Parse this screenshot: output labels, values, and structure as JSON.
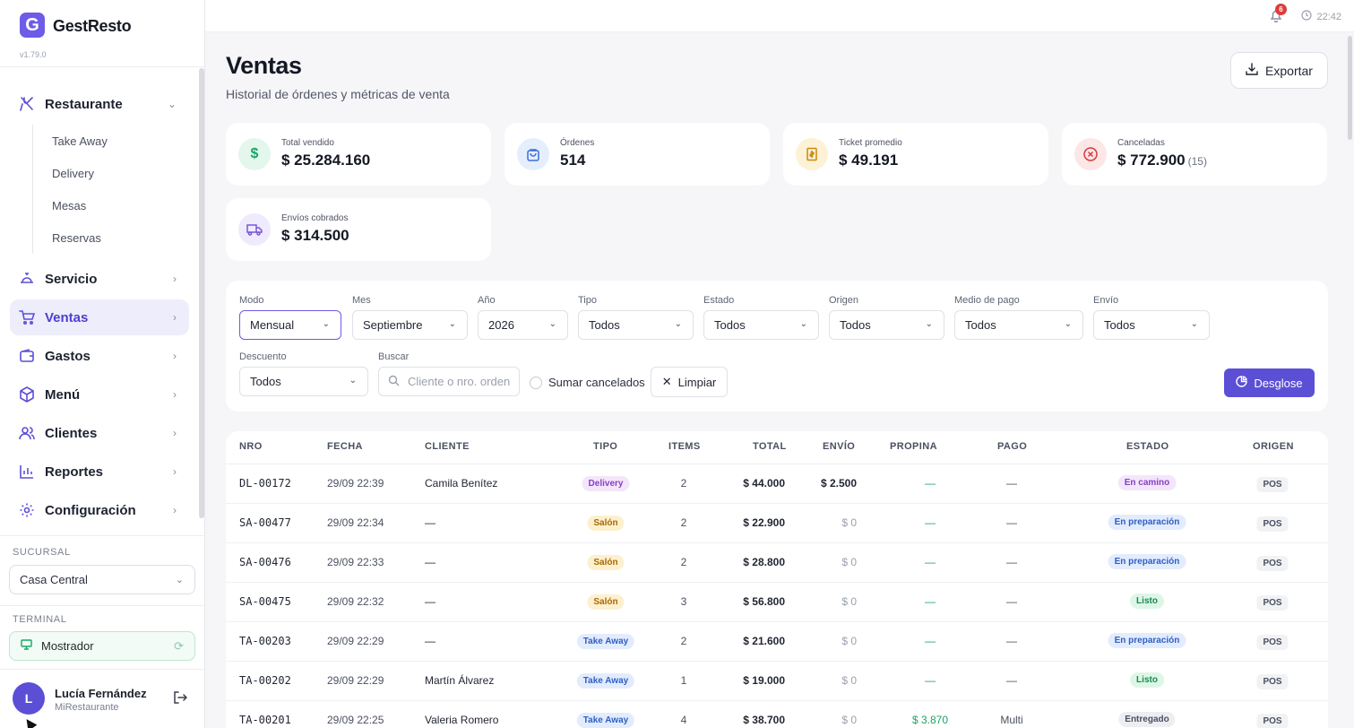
{
  "app": {
    "name": "GestResto",
    "logo_letter": "G",
    "version": "v1.79.0",
    "accent_color": "#5b4fd6"
  },
  "sidebar": {
    "restaurant": {
      "label": "Restaurante",
      "icon": "utensils-icon",
      "subitems": [
        "Take Away",
        "Delivery",
        "Mesas",
        "Reservas"
      ]
    },
    "items": [
      {
        "label": "Servicio",
        "icon": "service-bell-icon"
      },
      {
        "label": "Ventas",
        "icon": "cart-icon",
        "active": true
      },
      {
        "label": "Gastos",
        "icon": "wallet-icon"
      },
      {
        "label": "Menú",
        "icon": "box-icon"
      },
      {
        "label": "Clientes",
        "icon": "users-icon"
      },
      {
        "label": "Reportes",
        "icon": "bar-chart-icon"
      },
      {
        "label": "Configuración",
        "icon": "gear-icon"
      }
    ],
    "branch_label": "SUCURSAL",
    "branch_value": "Casa Central",
    "terminal_label": "TERMINAL",
    "terminal_value": "Mostrador",
    "user": {
      "initial": "L",
      "name": "Lucía Fernández",
      "restaurant": "MiRestaurante"
    }
  },
  "topbar": {
    "notifications": "6",
    "time": "22:42"
  },
  "header": {
    "title": "Ventas",
    "subtitle": "Historial de órdenes y métricas de venta",
    "export_label": "Exportar"
  },
  "stats": [
    {
      "label": "Total vendido",
      "value": "$ 25.284.160",
      "icon": "dollar-icon",
      "bg": "#e3f7ec",
      "fg": "#1aa366"
    },
    {
      "label": "Órdenes",
      "value": "514",
      "icon": "bag-icon",
      "bg": "#e5eefc",
      "fg": "#3b6fd8"
    },
    {
      "label": "Ticket promedio",
      "value": "$ 49.191",
      "icon": "receipt-icon",
      "bg": "#fdf1d6",
      "fg": "#c98a0a"
    },
    {
      "label": "Canceladas",
      "value": "$ 772.900",
      "extra": "(15)",
      "icon": "cancel-circle-icon",
      "bg": "#fde6e6",
      "fg": "#d63a3a"
    },
    {
      "label": "Envíos cobrados",
      "value": "$ 314.500",
      "icon": "truck-icon",
      "bg": "#efeafc",
      "fg": "#7a56d8"
    }
  ],
  "filters": {
    "modo": {
      "label": "Modo",
      "value": "Mensual"
    },
    "mes": {
      "label": "Mes",
      "value": "Septiembre"
    },
    "anio": {
      "label": "Año",
      "value": "2026"
    },
    "tipo": {
      "label": "Tipo",
      "value": "Todos"
    },
    "estado": {
      "label": "Estado",
      "value": "Todos"
    },
    "origen": {
      "label": "Origen",
      "value": "Todos"
    },
    "medio_pago": {
      "label": "Medio de pago",
      "value": "Todos"
    },
    "envio": {
      "label": "Envío",
      "value": "Todos"
    },
    "descuento": {
      "label": "Descuento",
      "value": "Todos"
    },
    "buscar": {
      "label": "Buscar",
      "placeholder": "Cliente o nro. orden"
    },
    "sumar_cancelados": "Sumar cancelados",
    "limpiar": "Limpiar",
    "desglose": "Desglose"
  },
  "table": {
    "headers": {
      "nro": "NRO",
      "fecha": "FECHA",
      "cliente": "CLIENTE",
      "tipo": "TIPO",
      "items": "ITEMS",
      "total": "TOTAL",
      "envio": "ENVÍO",
      "propina": "PROPINA",
      "pago": "PAGO",
      "estado": "ESTADO",
      "origen": "ORIGEN"
    },
    "rows": [
      {
        "nro": "DL-00172",
        "fecha": "29/09 22:39",
        "cliente": "Camila Benítez",
        "tipo": "Delivery",
        "items": "2",
        "total": "$ 44.000",
        "envio": "$ 2.500",
        "propina": "—",
        "pago": "—",
        "estado": "En camino",
        "origen": "POS"
      },
      {
        "nro": "SA-00477",
        "fecha": "29/09 22:34",
        "cliente": "—",
        "tipo": "Salón",
        "items": "2",
        "total": "$ 22.900",
        "envio": "$ 0",
        "propina": "—",
        "pago": "—",
        "estado": "En preparación",
        "origen": "POS"
      },
      {
        "nro": "SA-00476",
        "fecha": "29/09 22:33",
        "cliente": "—",
        "tipo": "Salón",
        "items": "2",
        "total": "$ 28.800",
        "envio": "$ 0",
        "propina": "—",
        "pago": "—",
        "estado": "En preparación",
        "origen": "POS"
      },
      {
        "nro": "SA-00475",
        "fecha": "29/09 22:32",
        "cliente": "—",
        "tipo": "Salón",
        "items": "3",
        "total": "$ 56.800",
        "envio": "$ 0",
        "propina": "—",
        "pago": "—",
        "estado": "Listo",
        "origen": "POS"
      },
      {
        "nro": "TA-00203",
        "fecha": "29/09 22:29",
        "cliente": "—",
        "tipo": "Take Away",
        "items": "2",
        "total": "$ 21.600",
        "envio": "$ 0",
        "propina": "—",
        "pago": "—",
        "estado": "En preparación",
        "origen": "POS"
      },
      {
        "nro": "TA-00202",
        "fecha": "29/09 22:29",
        "cliente": "Martín Álvarez",
        "tipo": "Take Away",
        "items": "1",
        "total": "$ 19.000",
        "envio": "$ 0",
        "propina": "—",
        "pago": "—",
        "estado": "Listo",
        "origen": "POS"
      },
      {
        "nro": "TA-00201",
        "fecha": "29/09 22:25",
        "cliente": "Valeria Romero",
        "tipo": "Take Away",
        "items": "4",
        "total": "$ 38.700",
        "envio": "$ 0",
        "propina": "$ 3.870",
        "pago": "Multi",
        "estado": "Entregado",
        "origen": "POS"
      }
    ]
  },
  "pill_colors": {
    "Delivery": {
      "bg": "#f3e6fb",
      "fg": "#8a3fc4"
    },
    "Salón": {
      "bg": "#fdf0cf",
      "fg": "#a86a00"
    },
    "Take Away": {
      "bg": "#e3ecfd",
      "fg": "#2f5fc4"
    },
    "En camino": {
      "bg": "#f3e6fb",
      "fg": "#8a3fc4"
    },
    "En preparación": {
      "bg": "#e3ecfd",
      "fg": "#2f5fc4"
    },
    "Listo": {
      "bg": "#def6e7",
      "fg": "#168a52"
    },
    "Entregado": {
      "bg": "#eceef1",
      "fg": "#4a5060"
    }
  }
}
